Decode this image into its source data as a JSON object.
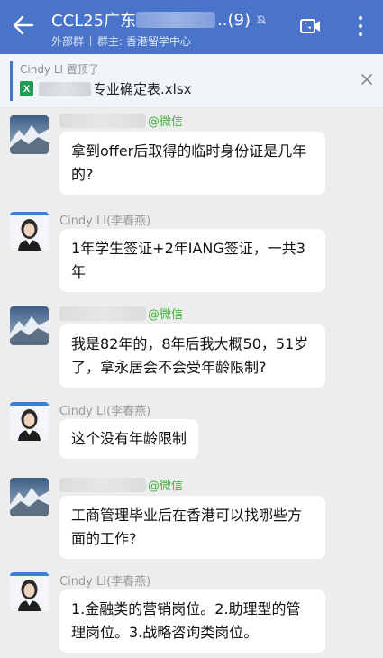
{
  "header": {
    "title_prefix": "CCL25广东",
    "title_suffix": "..(9)",
    "group_type": "外部群",
    "group_owner": "群主: 香港留学中心"
  },
  "pinned": {
    "label": "Cindy LI 置顶了",
    "file_icon": "X",
    "file_name": "专业确定表.xlsx"
  },
  "messages": [
    {
      "sender_suffix": "@微信",
      "text": "拿到offer后取得的临时身份证是几年的?"
    },
    {
      "sender": "Cindy LI(李春燕)",
      "text": "1年学生签证+2年IANG签证，一共3年"
    },
    {
      "sender_suffix": "@微信",
      "text": "我是82年的，8年后我大概50，51岁了，拿永居会不会受年龄限制?"
    },
    {
      "sender": "Cindy LI(李春燕)",
      "text": "这个没有年龄限制"
    },
    {
      "sender_suffix": "@微信",
      "text": "工商管理毕业后在香港可以找哪些方面的工作?"
    },
    {
      "sender": "Cindy LI(李春燕)",
      "text": "1.金融类的营销岗位。2.助理型的管理岗位。3.战略咨询类岗位。"
    }
  ],
  "icons": {
    "back": "back-arrow-icon",
    "mute": "mute-bell-icon",
    "call": "video-call-icon",
    "more": "more-vertical-icon",
    "close": "close-icon"
  },
  "colors": {
    "header_bg": "#4a74c9",
    "wechat_green": "#3fb33f",
    "excel_green": "#1f9d55"
  }
}
